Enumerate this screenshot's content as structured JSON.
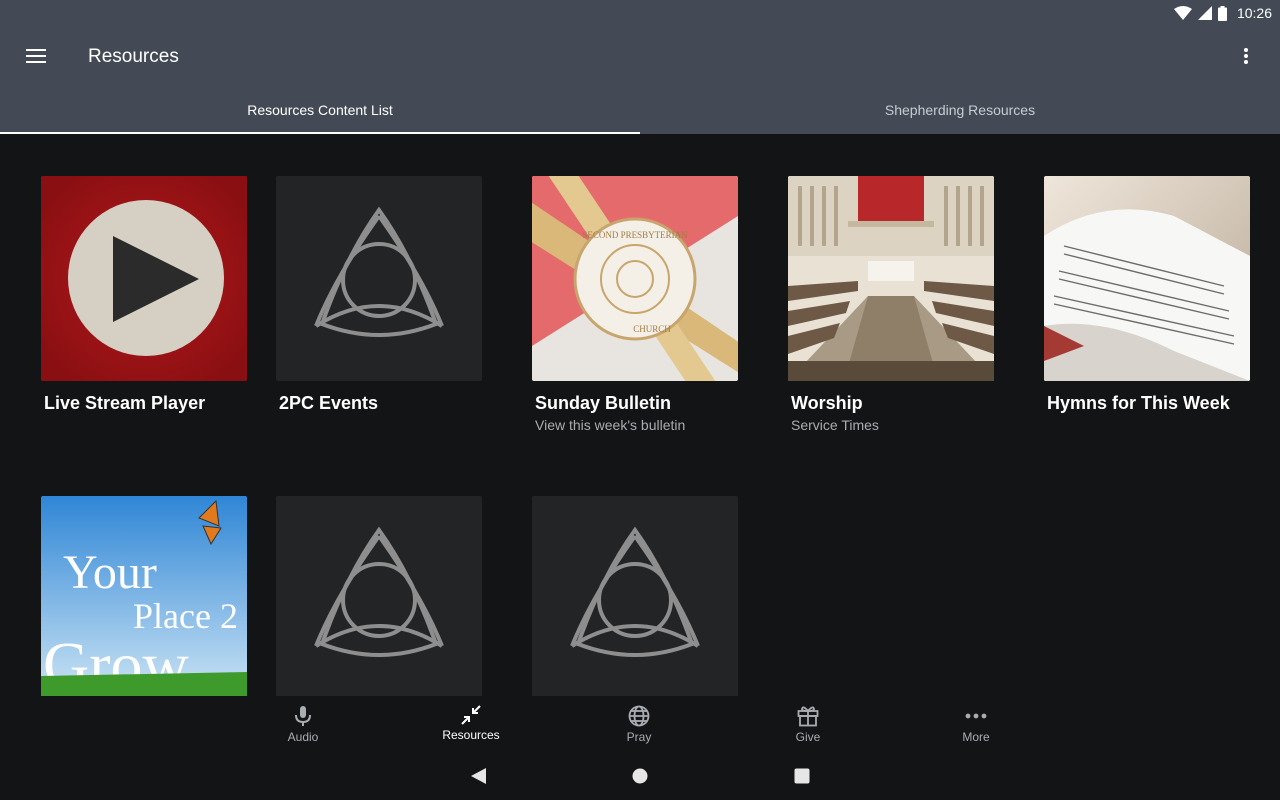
{
  "status_bar": {
    "time": "10:26"
  },
  "app_bar": {
    "title": "Resources"
  },
  "tabs": [
    {
      "label": "Resources Content List",
      "active": true
    },
    {
      "label": "Shepherding Resources",
      "active": false
    }
  ],
  "cards": [
    {
      "title": "Live Stream Player",
      "subtitle": "",
      "image": "play-button-icon"
    },
    {
      "title": "2PC Events",
      "subtitle": "",
      "image": "trinity-knot-icon"
    },
    {
      "title": "Sunday Bulletin",
      "subtitle": "View this week's bulletin",
      "image": "bulletin-image"
    },
    {
      "title": "Worship",
      "subtitle": "Service Times",
      "image": "sanctuary-image"
    },
    {
      "title": "Hymns for This Week",
      "subtitle": "",
      "image": "hymnal-image"
    },
    {
      "title": "",
      "subtitle": "",
      "image": "your-place-2-grow-image",
      "image_text": [
        "Your",
        "Place 2",
        "Grow"
      ]
    },
    {
      "title": "",
      "subtitle": "",
      "image": "trinity-knot-icon"
    },
    {
      "title": "",
      "subtitle": "",
      "image": "trinity-knot-icon"
    }
  ],
  "bulletin_seal_text": {
    "top": "SECOND PRESBYTERIAN",
    "bottom": "CHURCH"
  },
  "bottom_nav": [
    {
      "label": "Audio",
      "icon": "microphone-icon",
      "active": false
    },
    {
      "label": "Resources",
      "icon": "compress-arrows-icon",
      "active": true
    },
    {
      "label": "Pray",
      "icon": "globe-icon",
      "active": false
    },
    {
      "label": "Give",
      "icon": "gift-icon",
      "active": false
    },
    {
      "label": "More",
      "icon": "more-dots-icon",
      "active": false
    }
  ],
  "colors": {
    "app_bar": "#434a55",
    "background": "#131416",
    "placeholder_tile": "#232426",
    "live_red": "#a31417"
  }
}
